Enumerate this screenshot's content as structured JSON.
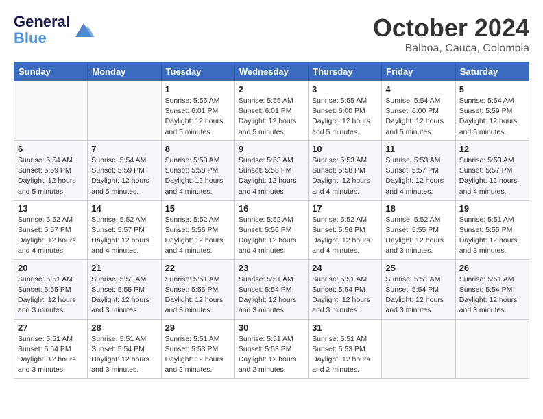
{
  "header": {
    "logo_line1": "General",
    "logo_line2": "Blue",
    "month": "October 2024",
    "location": "Balboa, Cauca, Colombia"
  },
  "weekdays": [
    "Sunday",
    "Monday",
    "Tuesday",
    "Wednesday",
    "Thursday",
    "Friday",
    "Saturday"
  ],
  "weeks": [
    [
      {
        "day": "",
        "info": ""
      },
      {
        "day": "",
        "info": ""
      },
      {
        "day": "1",
        "info": "Sunrise: 5:55 AM\nSunset: 6:01 PM\nDaylight: 12 hours\nand 5 minutes."
      },
      {
        "day": "2",
        "info": "Sunrise: 5:55 AM\nSunset: 6:01 PM\nDaylight: 12 hours\nand 5 minutes."
      },
      {
        "day": "3",
        "info": "Sunrise: 5:55 AM\nSunset: 6:00 PM\nDaylight: 12 hours\nand 5 minutes."
      },
      {
        "day": "4",
        "info": "Sunrise: 5:54 AM\nSunset: 6:00 PM\nDaylight: 12 hours\nand 5 minutes."
      },
      {
        "day": "5",
        "info": "Sunrise: 5:54 AM\nSunset: 5:59 PM\nDaylight: 12 hours\nand 5 minutes."
      }
    ],
    [
      {
        "day": "6",
        "info": "Sunrise: 5:54 AM\nSunset: 5:59 PM\nDaylight: 12 hours\nand 5 minutes."
      },
      {
        "day": "7",
        "info": "Sunrise: 5:54 AM\nSunset: 5:59 PM\nDaylight: 12 hours\nand 5 minutes."
      },
      {
        "day": "8",
        "info": "Sunrise: 5:53 AM\nSunset: 5:58 PM\nDaylight: 12 hours\nand 4 minutes."
      },
      {
        "day": "9",
        "info": "Sunrise: 5:53 AM\nSunset: 5:58 PM\nDaylight: 12 hours\nand 4 minutes."
      },
      {
        "day": "10",
        "info": "Sunrise: 5:53 AM\nSunset: 5:58 PM\nDaylight: 12 hours\nand 4 minutes."
      },
      {
        "day": "11",
        "info": "Sunrise: 5:53 AM\nSunset: 5:57 PM\nDaylight: 12 hours\nand 4 minutes."
      },
      {
        "day": "12",
        "info": "Sunrise: 5:53 AM\nSunset: 5:57 PM\nDaylight: 12 hours\nand 4 minutes."
      }
    ],
    [
      {
        "day": "13",
        "info": "Sunrise: 5:52 AM\nSunset: 5:57 PM\nDaylight: 12 hours\nand 4 minutes."
      },
      {
        "day": "14",
        "info": "Sunrise: 5:52 AM\nSunset: 5:57 PM\nDaylight: 12 hours\nand 4 minutes."
      },
      {
        "day": "15",
        "info": "Sunrise: 5:52 AM\nSunset: 5:56 PM\nDaylight: 12 hours\nand 4 minutes."
      },
      {
        "day": "16",
        "info": "Sunrise: 5:52 AM\nSunset: 5:56 PM\nDaylight: 12 hours\nand 4 minutes."
      },
      {
        "day": "17",
        "info": "Sunrise: 5:52 AM\nSunset: 5:56 PM\nDaylight: 12 hours\nand 4 minutes."
      },
      {
        "day": "18",
        "info": "Sunrise: 5:52 AM\nSunset: 5:55 PM\nDaylight: 12 hours\nand 3 minutes."
      },
      {
        "day": "19",
        "info": "Sunrise: 5:51 AM\nSunset: 5:55 PM\nDaylight: 12 hours\nand 3 minutes."
      }
    ],
    [
      {
        "day": "20",
        "info": "Sunrise: 5:51 AM\nSunset: 5:55 PM\nDaylight: 12 hours\nand 3 minutes."
      },
      {
        "day": "21",
        "info": "Sunrise: 5:51 AM\nSunset: 5:55 PM\nDaylight: 12 hours\nand 3 minutes."
      },
      {
        "day": "22",
        "info": "Sunrise: 5:51 AM\nSunset: 5:55 PM\nDaylight: 12 hours\nand 3 minutes."
      },
      {
        "day": "23",
        "info": "Sunrise: 5:51 AM\nSunset: 5:54 PM\nDaylight: 12 hours\nand 3 minutes."
      },
      {
        "day": "24",
        "info": "Sunrise: 5:51 AM\nSunset: 5:54 PM\nDaylight: 12 hours\nand 3 minutes."
      },
      {
        "day": "25",
        "info": "Sunrise: 5:51 AM\nSunset: 5:54 PM\nDaylight: 12 hours\nand 3 minutes."
      },
      {
        "day": "26",
        "info": "Sunrise: 5:51 AM\nSunset: 5:54 PM\nDaylight: 12 hours\nand 3 minutes."
      }
    ],
    [
      {
        "day": "27",
        "info": "Sunrise: 5:51 AM\nSunset: 5:54 PM\nDaylight: 12 hours\nand 3 minutes."
      },
      {
        "day": "28",
        "info": "Sunrise: 5:51 AM\nSunset: 5:54 PM\nDaylight: 12 hours\nand 3 minutes."
      },
      {
        "day": "29",
        "info": "Sunrise: 5:51 AM\nSunset: 5:53 PM\nDaylight: 12 hours\nand 2 minutes."
      },
      {
        "day": "30",
        "info": "Sunrise: 5:51 AM\nSunset: 5:53 PM\nDaylight: 12 hours\nand 2 minutes."
      },
      {
        "day": "31",
        "info": "Sunrise: 5:51 AM\nSunset: 5:53 PM\nDaylight: 12 hours\nand 2 minutes."
      },
      {
        "day": "",
        "info": ""
      },
      {
        "day": "",
        "info": ""
      }
    ]
  ]
}
